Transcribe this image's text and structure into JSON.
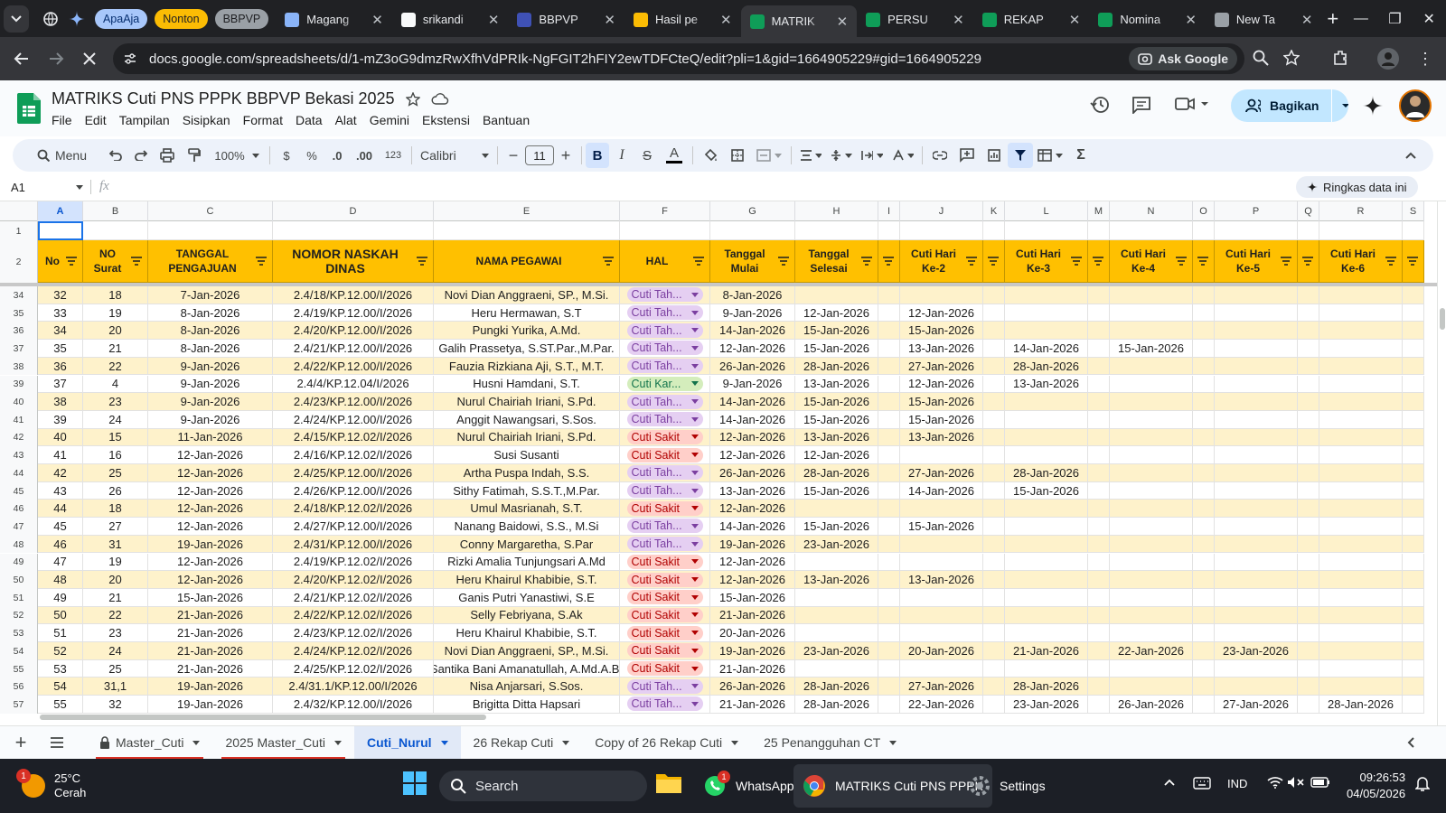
{
  "browser": {
    "tabs": [
      {
        "label": "Magang",
        "fav": "#8ab4f8"
      },
      {
        "label": "srikandi",
        "fav": "#f8f9fa"
      },
      {
        "label": "BBPVP",
        "fav": "#3f51b5"
      },
      {
        "label": "Hasil pe",
        "fav": "#fbbc04"
      },
      {
        "label": "MATRIK",
        "fav": "#0f9d58",
        "active": true
      },
      {
        "label": "PERSU",
        "fav": "#0f9d58"
      },
      {
        "label": "REKAP",
        "fav": "#0f9d58"
      },
      {
        "label": "Nomina",
        "fav": "#0f9d58"
      },
      {
        "label": "New Ta",
        "fav": "#9aa0a6"
      }
    ],
    "bookmarks": [
      {
        "label": "ApaAja",
        "bg": "#a8c7fa",
        "fg": "#062e6f"
      },
      {
        "label": "Nonton",
        "bg": "#fbbc04",
        "fg": "#202124"
      },
      {
        "label": "BBPVP",
        "bg": "#9aa0a6",
        "fg": "#202124"
      }
    ],
    "url": "docs.google.com/spreadsheets/d/1-mZ3oG9dmzRwXfhVdPRIk-NgFGIT2hFIY2ewTDFCteQ/edit?pli=1&gid=1664905229#gid=1664905229",
    "ask_google": "Ask Google"
  },
  "sheets": {
    "title": "MATRIKS  Cuti PNS PPPK BBPVP Bekasi 2025",
    "menus": [
      "File",
      "Edit",
      "Tampilan",
      "Sisipkan",
      "Format",
      "Data",
      "Alat",
      "Gemini",
      "Ekstensi",
      "Bantuan"
    ],
    "share_label": "Bagikan",
    "toolbar": {
      "menu_search": "Menu",
      "zoom": "100%",
      "currency": "$",
      "percent": "%",
      "dec_dec": ".0",
      "dec_inc": ".00",
      "num_format": "123",
      "font": "Calibri",
      "font_size": "11"
    },
    "name_box": "A1",
    "fx": "fx",
    "summarize": "Ringkas data ini"
  },
  "grid": {
    "columns": [
      "A",
      "B",
      "C",
      "D",
      "E",
      "F",
      "G",
      "H",
      "I",
      "J",
      "K",
      "L",
      "M",
      "N",
      "O",
      "P",
      "Q",
      "R",
      "S"
    ],
    "header_row": [
      "No",
      "NO Surat",
      "TANGGAL PENGAJUAN",
      "NOMOR NASKAH DINAS",
      "NAMA PEGAWAI",
      "HAL",
      "Tanggal Mulai",
      "Tanggal Selesai",
      "",
      "Cuti Hari Ke-2",
      "",
      "Cuti Hari Ke-3",
      "",
      "Cuti Hari Ke-4",
      "",
      "Cuti Hari Ke-5",
      "",
      "Cuti Hari Ke-6",
      ""
    ],
    "rows": [
      {
        "r": "34",
        "no": "32",
        "surat": "18",
        "tgl": "7-Jan-2026",
        "nomor": "2.4/18/KP.12.00/I/2026",
        "nama": "Novi Dian Anggraeni, SP., M.Si.",
        "hal": "Cuti Tah...",
        "mulai": "8-Jan-2026",
        "selesai": "",
        "h2": "",
        "h3": "",
        "h4": "",
        "h5": "",
        "h6": ""
      },
      {
        "r": "35",
        "no": "33",
        "surat": "19",
        "tgl": "8-Jan-2026",
        "nomor": "2.4/19/KP.12.00/I/2026",
        "nama": "Heru Hermawan, S.T",
        "hal": "Cuti Tah...",
        "mulai": "9-Jan-2026",
        "selesai": "12-Jan-2026",
        "h2": "12-Jan-2026",
        "h3": "",
        "h4": "",
        "h5": "",
        "h6": ""
      },
      {
        "r": "36",
        "no": "34",
        "surat": "20",
        "tgl": "8-Jan-2026",
        "nomor": "2.4/20/KP.12.00/I/2026",
        "nama": "Pungki Yurika, A.Md.",
        "hal": "Cuti Tah...",
        "mulai": "14-Jan-2026",
        "selesai": "15-Jan-2026",
        "h2": "15-Jan-2026",
        "h3": "",
        "h4": "",
        "h5": "",
        "h6": ""
      },
      {
        "r": "37",
        "no": "35",
        "surat": "21",
        "tgl": "8-Jan-2026",
        "nomor": "2.4/21/KP.12.00/I/2026",
        "nama": "Galih Prassetya, S.ST.Par.,M.Par.",
        "hal": "Cuti Tah...",
        "mulai": "12-Jan-2026",
        "selesai": "15-Jan-2026",
        "h2": "13-Jan-2026",
        "h3": "14-Jan-2026",
        "h4": "15-Jan-2026",
        "h5": "",
        "h6": ""
      },
      {
        "r": "38",
        "no": "36",
        "surat": "22",
        "tgl": "9-Jan-2026",
        "nomor": "2.4/22/KP.12.00/I/2026",
        "nama": "Fauzia Rizkiana Aji, S.T., M.T.",
        "hal": "Cuti Tah...",
        "mulai": "26-Jan-2026",
        "selesai": "28-Jan-2026",
        "h2": "27-Jan-2026",
        "h3": "28-Jan-2026",
        "h4": "",
        "h5": "",
        "h6": ""
      },
      {
        "r": "39",
        "no": "37",
        "surat": "4",
        "tgl": "9-Jan-2026",
        "nomor": "2.4/4/KP.12.04/I/2026",
        "nama": "Husni Hamdani, S.T.",
        "hal": "Cuti Kar...",
        "mulai": "9-Jan-2026",
        "selesai": "13-Jan-2026",
        "h2": "12-Jan-2026",
        "h3": "13-Jan-2026",
        "h4": "",
        "h5": "",
        "h6": ""
      },
      {
        "r": "40",
        "no": "38",
        "surat": "23",
        "tgl": "9-Jan-2026",
        "nomor": "2.4/23/KP.12.00/I/2026",
        "nama": "Nurul Chairiah Iriani, S.Pd.",
        "hal": "Cuti Tah...",
        "mulai": "14-Jan-2026",
        "selesai": "15-Jan-2026",
        "h2": "15-Jan-2026",
        "h3": "",
        "h4": "",
        "h5": "",
        "h6": ""
      },
      {
        "r": "41",
        "no": "39",
        "surat": "24",
        "tgl": "9-Jan-2026",
        "nomor": "2.4/24/KP.12.00/I/2026",
        "nama": "Anggit Nawangsari, S.Sos.",
        "hal": "Cuti Tah...",
        "mulai": "14-Jan-2026",
        "selesai": "15-Jan-2026",
        "h2": "15-Jan-2026",
        "h3": "",
        "h4": "",
        "h5": "",
        "h6": ""
      },
      {
        "r": "42",
        "no": "40",
        "surat": "15",
        "tgl": "11-Jan-2026",
        "nomor": "2.4/15/KP.12.02/I/2026",
        "nama": "Nurul Chairiah Iriani, S.Pd.",
        "hal": "Cuti Sakit",
        "mulai": "12-Jan-2026",
        "selesai": "13-Jan-2026",
        "h2": "13-Jan-2026",
        "h3": "",
        "h4": "",
        "h5": "",
        "h6": ""
      },
      {
        "r": "43",
        "no": "41",
        "surat": "16",
        "tgl": "12-Jan-2026",
        "nomor": "2.4/16/KP.12.02/I/2026",
        "nama": "Susi Susanti",
        "hal": "Cuti Sakit",
        "mulai": "12-Jan-2026",
        "selesai": "12-Jan-2026",
        "h2": "",
        "h3": "",
        "h4": "",
        "h5": "",
        "h6": ""
      },
      {
        "r": "44",
        "no": "42",
        "surat": "25",
        "tgl": "12-Jan-2026",
        "nomor": "2.4/25/KP.12.00/I/2026",
        "nama": "Artha Puspa Indah, S.S.",
        "hal": "Cuti Tah...",
        "mulai": "26-Jan-2026",
        "selesai": "28-Jan-2026",
        "h2": "27-Jan-2026",
        "h3": "28-Jan-2026",
        "h4": "",
        "h5": "",
        "h6": ""
      },
      {
        "r": "45",
        "no": "43",
        "surat": "26",
        "tgl": "12-Jan-2026",
        "nomor": "2.4/26/KP.12.00/I/2026",
        "nama": "Sithy Fatimah, S.S.T.,M.Par.",
        "hal": "Cuti Tah...",
        "mulai": "13-Jan-2026",
        "selesai": "15-Jan-2026",
        "h2": "14-Jan-2026",
        "h3": "15-Jan-2026",
        "h4": "",
        "h5": "",
        "h6": ""
      },
      {
        "r": "46",
        "no": "44",
        "surat": "18",
        "tgl": "12-Jan-2026",
        "nomor": "2.4/18/KP.12.02/I/2026",
        "nama": "Umul Masrianah, S.T.",
        "hal": "Cuti Sakit",
        "mulai": "12-Jan-2026",
        "selesai": "",
        "h2": "",
        "h3": "",
        "h4": "",
        "h5": "",
        "h6": ""
      },
      {
        "r": "47",
        "no": "45",
        "surat": "27",
        "tgl": "12-Jan-2026",
        "nomor": "2.4/27/KP.12.00/I/2026",
        "nama": "Nanang Baidowi, S.S., M.Si",
        "hal": "Cuti Tah...",
        "mulai": "14-Jan-2026",
        "selesai": "15-Jan-2026",
        "h2": "15-Jan-2026",
        "h3": "",
        "h4": "",
        "h5": "",
        "h6": ""
      },
      {
        "r": "48",
        "no": "46",
        "surat": "31",
        "tgl": "19-Jan-2026",
        "nomor": "2.4/31/KP.12.00/I/2026",
        "nama": "Conny Margaretha, S.Par",
        "hal": "Cuti Tah...",
        "mulai": "19-Jan-2026",
        "selesai": "23-Jan-2026",
        "h2": "",
        "h3": "",
        "h4": "",
        "h5": "",
        "h6": ""
      },
      {
        "r": "49",
        "no": "47",
        "surat": "19",
        "tgl": "12-Jan-2026",
        "nomor": "2.4/19/KP.12.02/I/2026",
        "nama": "Rizki Amalia Tunjungsari A.Md",
        "hal": "Cuti Sakit",
        "mulai": "12-Jan-2026",
        "selesai": "",
        "h2": "",
        "h3": "",
        "h4": "",
        "h5": "",
        "h6": ""
      },
      {
        "r": "50",
        "no": "48",
        "surat": "20",
        "tgl": "12-Jan-2026",
        "nomor": "2.4/20/KP.12.02/I/2026",
        "nama": "Heru Khairul Khabibie, S.T.",
        "hal": "Cuti Sakit",
        "mulai": "12-Jan-2026",
        "selesai": "13-Jan-2026",
        "h2": "13-Jan-2026",
        "h3": "",
        "h4": "",
        "h5": "",
        "h6": ""
      },
      {
        "r": "51",
        "no": "49",
        "surat": "21",
        "tgl": "15-Jan-2026",
        "nomor": "2.4/21/KP.12.02/I/2026",
        "nama": "Ganis Putri Yanastiwi, S.E",
        "hal": "Cuti Sakit",
        "mulai": "15-Jan-2026",
        "selesai": "",
        "h2": "",
        "h3": "",
        "h4": "",
        "h5": "",
        "h6": ""
      },
      {
        "r": "52",
        "no": "50",
        "surat": "22",
        "tgl": "21-Jan-2026",
        "nomor": "2.4/22/KP.12.02/I/2026",
        "nama": "Selly Febriyana, S.Ak",
        "hal": "Cuti Sakit",
        "mulai": "21-Jan-2026",
        "selesai": "",
        "h2": "",
        "h3": "",
        "h4": "",
        "h5": "",
        "h6": ""
      },
      {
        "r": "53",
        "no": "51",
        "surat": "23",
        "tgl": "21-Jan-2026",
        "nomor": "2.4/23/KP.12.02/I/2026",
        "nama": "Heru Khairul Khabibie, S.T.",
        "hal": "Cuti Sakit",
        "mulai": "20-Jan-2026",
        "selesai": "",
        "h2": "",
        "h3": "",
        "h4": "",
        "h5": "",
        "h6": ""
      },
      {
        "r": "54",
        "no": "52",
        "surat": "24",
        "tgl": "21-Jan-2026",
        "nomor": "2.4/24/KP.12.02/I/2026",
        "nama": "Novi Dian Anggraeni, SP., M.Si.",
        "hal": "Cuti Sakit",
        "mulai": "19-Jan-2026",
        "selesai": "23-Jan-2026",
        "h2": "20-Jan-2026",
        "h3": "21-Jan-2026",
        "h4": "22-Jan-2026",
        "h5": "23-Jan-2026",
        "h6": ""
      },
      {
        "r": "55",
        "no": "53",
        "surat": "25",
        "tgl": "21-Jan-2026",
        "nomor": "2.4/25/KP.12.02/I/2026",
        "nama": "Santika Bani Amanatullah, A.Md.A.B.",
        "hal": "Cuti Sakit",
        "mulai": "21-Jan-2026",
        "selesai": "",
        "h2": "",
        "h3": "",
        "h4": "",
        "h5": "",
        "h6": ""
      },
      {
        "r": "56",
        "no": "54",
        "surat": "31,1",
        "tgl": "19-Jan-2026",
        "nomor": "2.4/31.1/KP.12.00/I/2026",
        "nama": "Nisa Anjarsari, S.Sos.",
        "hal": "Cuti Tah...",
        "mulai": "26-Jan-2026",
        "selesai": "28-Jan-2026",
        "h2": "27-Jan-2026",
        "h3": "28-Jan-2026",
        "h4": "",
        "h5": "",
        "h6": ""
      },
      {
        "r": "57",
        "no": "55",
        "surat": "32",
        "tgl": "19-Jan-2026",
        "nomor": "2.4/32/KP.12.00/I/2026",
        "nama": "Brigitta Ditta Hapsari",
        "hal": "Cuti Tah...",
        "mulai": "21-Jan-2026",
        "selesai": "28-Jan-2026",
        "h2": "22-Jan-2026",
        "h3": "23-Jan-2026",
        "h4": "26-Jan-2026",
        "h5": "27-Jan-2026",
        "h6": "28-Jan-2026"
      }
    ]
  },
  "sheet_tabs": [
    {
      "label": "Master_Cuti",
      "locked": true,
      "underline": true
    },
    {
      "label": "2025 Master_Cuti",
      "underline": true
    },
    {
      "label": "Cuti_Nurul",
      "active": true
    },
    {
      "label": "26 Rekap Cuti"
    },
    {
      "label": "Copy of 26 Rekap Cuti"
    },
    {
      "label": "25 Penangguhan CT"
    }
  ],
  "taskbar": {
    "weather_temp": "25°C",
    "weather_desc": "Cerah",
    "weather_badge": "1",
    "search": "Search",
    "apps": [
      {
        "label": "WhatsApp",
        "badge": "1"
      },
      {
        "label": "MATRIKS Cuti PNS PPPK"
      },
      {
        "label": "Settings"
      }
    ],
    "lang": "IND",
    "time": "09:26:53",
    "date": "04/05/2026"
  },
  "colors": {
    "header_fill": "#ffc000",
    "row_band": "#fef2cb",
    "chip_tahunan": "#e5cff2",
    "chip_sakit": "#ffcfc9",
    "chip_karena": "#d4edbc"
  }
}
